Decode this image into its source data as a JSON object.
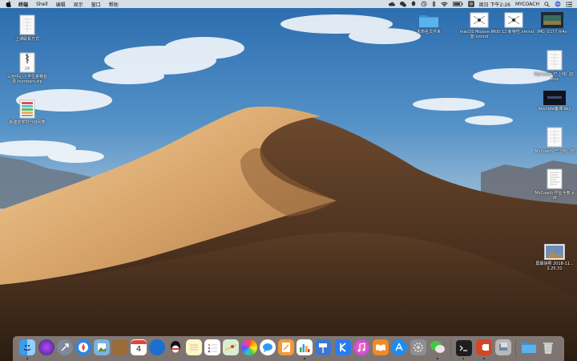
{
  "menubar": {
    "app_name": "终端",
    "menus": [
      "Shell",
      "编辑",
      "显示",
      "窗口",
      "帮助"
    ],
    "clock": "周日 下午2:26",
    "user": "MYCOACH"
  },
  "desktop_icons": [
    {
      "label": "上课联系方式"
    },
    {
      "label": "三亚中心小学生参赛名单.numbers.zip"
    },
    {
      "label": "新建的学员分班列表"
    },
    {
      "label": "未命名文件夹"
    },
    {
      "label": "macOS Mojave 新功能.xmind"
    },
    {
      "label": "iOS 12 新特性.xmind"
    },
    {
      "label": "IMG_0177.m4v"
    },
    {
      "label": "MyCoach 已上线门店.xlsx"
    },
    {
      "label": "Keynote备课.key"
    },
    {
      "label": "MyCoach 已上线门店"
    },
    {
      "label": "MyCoach 作业手册.pdf"
    },
    {
      "label": "屏幕快照 2018-11...2.25.31"
    }
  ],
  "dock": {
    "calendar_day": "4"
  },
  "colors": {
    "menubar_bg": "#eeeeee",
    "folder_blue": "#4aa3e0"
  }
}
